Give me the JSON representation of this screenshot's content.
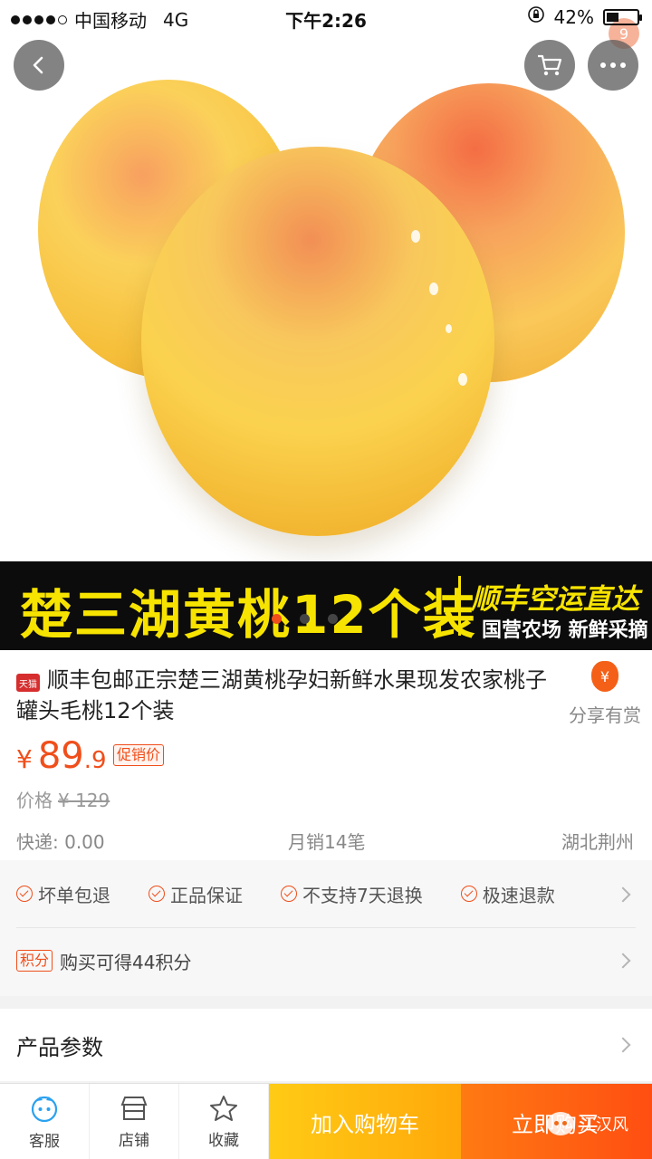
{
  "status_bar": {
    "carrier": "中国移动",
    "network": "4G",
    "time": "下午2:26",
    "battery_text": "42%",
    "battery_level": 0.42,
    "badge_count": "9"
  },
  "banner": {
    "title": "楚三湖黄桃12个装",
    "slogan": "顺丰空运直达",
    "subslogan": "国营农场 新鲜采摘"
  },
  "product": {
    "badge": "天猫",
    "title": "顺丰包邮正宗楚三湖黄桃孕妇新鲜水果现发农家桃子罐头毛桃12个装",
    "share_label": "分享有赏",
    "currency": "¥",
    "price_int": "89",
    "price_dec": ".9",
    "promo_tag": "促销价",
    "orig_label": "价格",
    "orig_price": "¥ 129",
    "shipping": "快递: 0.00",
    "sales": "月销14笔",
    "location": "湖北荆州"
  },
  "guarantees": [
    "坏单包退",
    "正品保证",
    "不支持7天退换",
    "极速退款"
  ],
  "points": {
    "tag": "积分",
    "text": "购买可得44积分"
  },
  "params_label": "产品参数",
  "bottom_bar": {
    "service": "客服",
    "shop": "店铺",
    "favorite": "收藏",
    "add_cart": "加入购物车",
    "buy_now": "立即购买"
  },
  "watermark": "江汉风",
  "colors": {
    "accent": "#f04e1b",
    "banner_text": "#f7e300",
    "cart_button": "#ffb20e",
    "buy_button": "#ff5a12"
  }
}
